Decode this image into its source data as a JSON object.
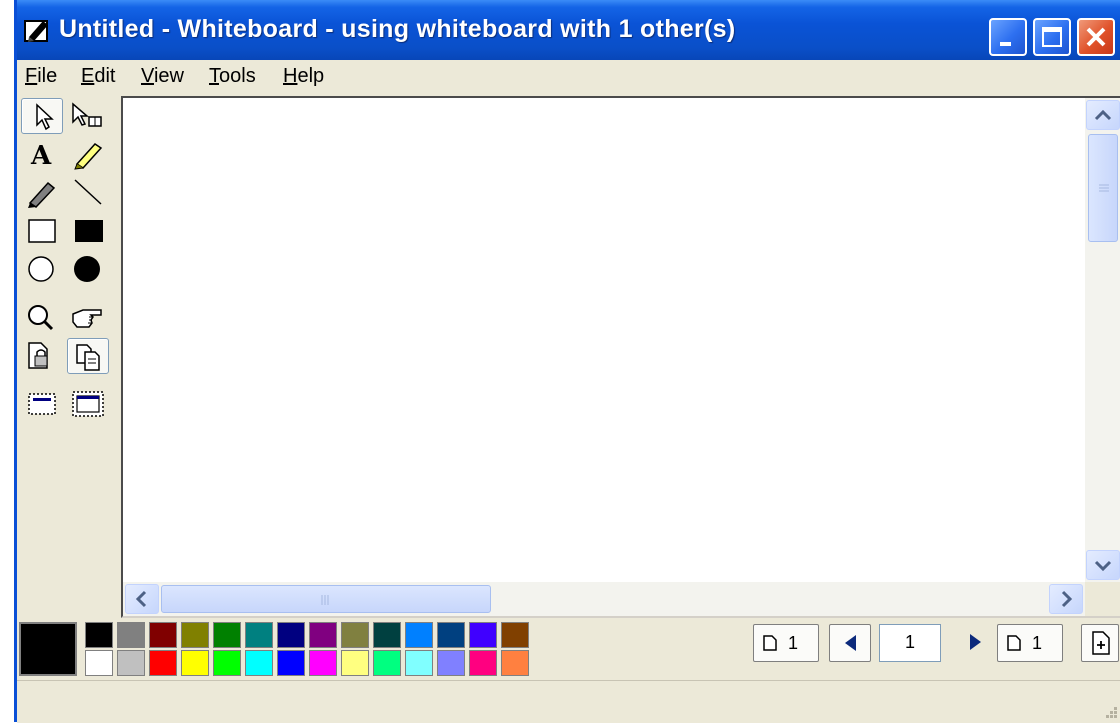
{
  "window": {
    "title": "Untitled - Whiteboard - using whiteboard with 1 other(s)",
    "app_icon": "whiteboard-pen-icon"
  },
  "title_buttons": [
    "minimize-icon",
    "maximize-icon",
    "close-icon"
  ],
  "menu": {
    "items": [
      {
        "label": "File",
        "accel": "F",
        "rest": "ile"
      },
      {
        "label": "Edit",
        "accel": "E",
        "rest": "dit"
      },
      {
        "label": "View",
        "accel": "V",
        "rest": "iew"
      },
      {
        "label": "Tools",
        "accel": "T",
        "rest": "ools"
      },
      {
        "label": "Help",
        "accel": "H",
        "rest": "elp"
      }
    ]
  },
  "toolbox": {
    "tools": [
      {
        "name": "selector-icon",
        "pressed": true
      },
      {
        "name": "eraser-select-icon",
        "pressed": false
      },
      {
        "name": "text-icon",
        "glyph": "A",
        "pressed": false
      },
      {
        "name": "highlighter-icon",
        "pressed": false
      },
      {
        "name": "pen-icon",
        "pressed": false
      },
      {
        "name": "line-icon",
        "pressed": false
      },
      {
        "name": "unfilled-rectangle-icon",
        "pressed": false
      },
      {
        "name": "filled-rectangle-icon",
        "pressed": false
      },
      {
        "name": "unfilled-ellipse-icon",
        "pressed": false
      },
      {
        "name": "filled-ellipse-icon",
        "pressed": false
      },
      {
        "name": "zoom-icon",
        "pressed": false
      },
      {
        "name": "remote-pointer-icon",
        "pressed": false
      },
      {
        "name": "lock-contents-icon",
        "pressed": false
      },
      {
        "name": "synchronize-icon",
        "pressed": true
      },
      {
        "name": "select-area-icon",
        "pressed": false
      },
      {
        "name": "select-window-icon",
        "pressed": false
      }
    ]
  },
  "palette": {
    "current_color": "#000000",
    "top_row": [
      "#000000",
      "#808080",
      "#800000",
      "#808000",
      "#008000",
      "#008080",
      "#000080",
      "#800080",
      "#808040",
      "#004040",
      "#0080ff",
      "#004080",
      "#4000ff",
      "#804000"
    ],
    "bottom_row": [
      "#ffffff",
      "#c0c0c0",
      "#ff0000",
      "#ffff00",
      "#00ff00",
      "#00ffff",
      "#0000ff",
      "#ff00ff",
      "#ffff80",
      "#00ff80",
      "#80ffff",
      "#8080ff",
      "#ff0080",
      "#ff8040"
    ]
  },
  "pager": {
    "first_page_label": "1",
    "current_page": "1",
    "last_page_label": "1"
  }
}
